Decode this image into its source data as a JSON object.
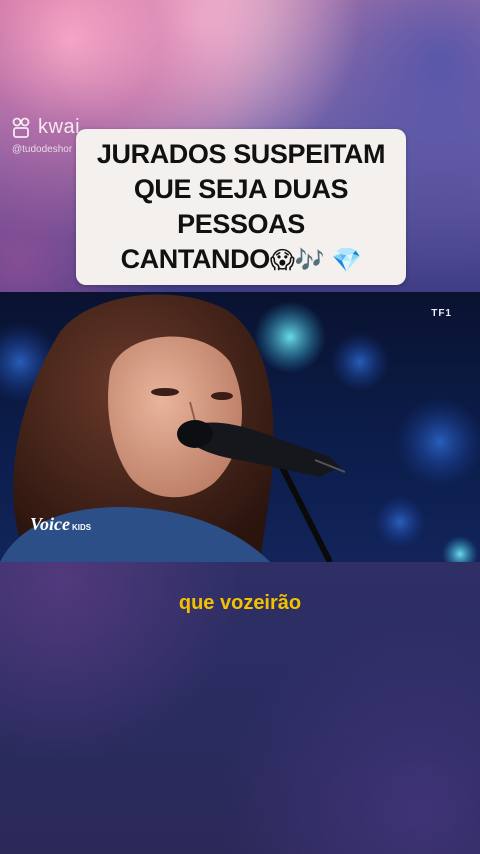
{
  "watermark": {
    "brand": "kwai",
    "handle": "@tudodeshor",
    "icon": "kwai-logo-icon"
  },
  "caption": {
    "line1": "JURADOS SUSPEITAM",
    "line2": "QUE SEJA DUAS",
    "line3": "PESSOAS",
    "line4_text": "CANTANDO",
    "line4_emojis": "😱🎶 💎"
  },
  "video": {
    "channel": "TF1",
    "show_logo": "Voice",
    "show_logo_sub": "KIDS"
  },
  "subtitle": "que vozeirão",
  "colors": {
    "subtitle": "#f2c200",
    "caption_bg": "#f4f0ee",
    "stage_blue": "#0b1d4a"
  }
}
